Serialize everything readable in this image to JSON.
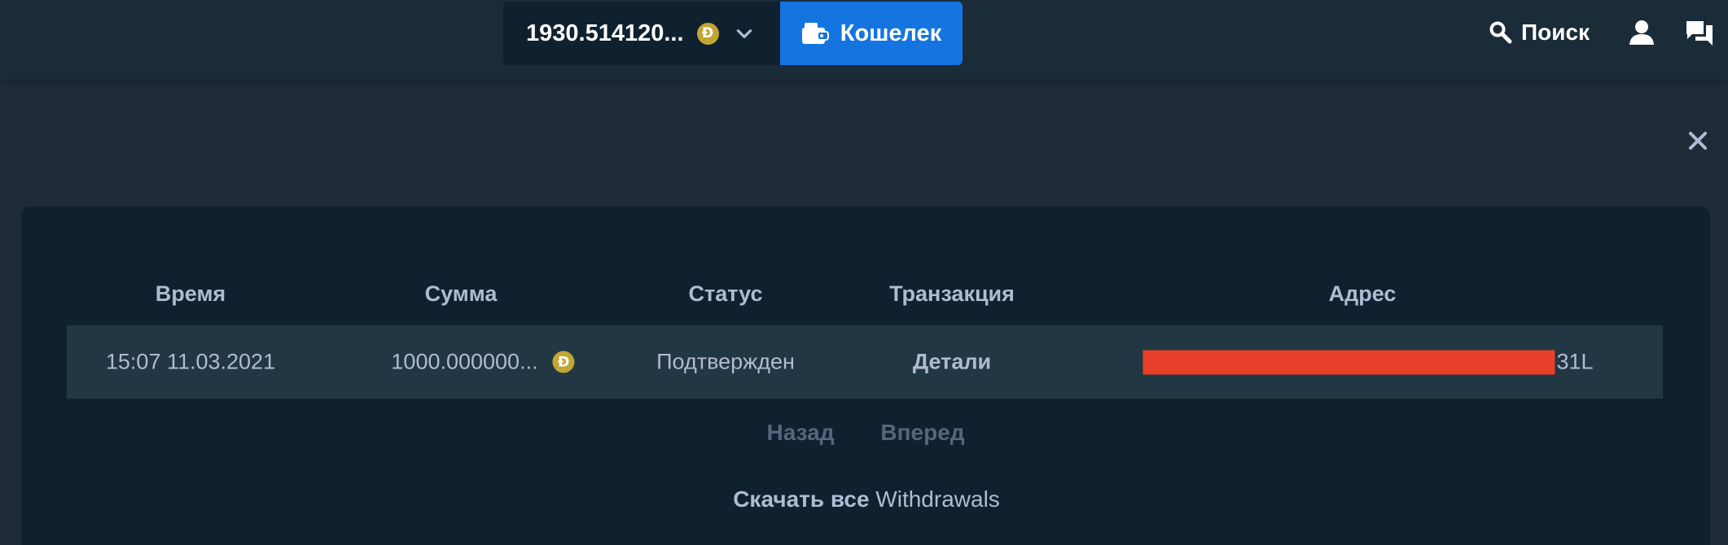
{
  "header": {
    "balance": "1930.514120...",
    "currency_symbol": "Ð",
    "wallet_label": "Кошелек",
    "search_label": "Поиск"
  },
  "table": {
    "columns": [
      "Время",
      "Сумма",
      "Статус",
      "Транзакция",
      "Адрес"
    ],
    "rows": [
      {
        "time": "15:07 11.03.2021",
        "amount": "1000.000000...",
        "status": "Подтвержден",
        "transaction": "Детали",
        "address_tail": "31L"
      }
    ]
  },
  "pagination": {
    "prev": "Назад",
    "next": "Вперед"
  },
  "download": {
    "label": "Скачать все",
    "suffix": "Withdrawals"
  },
  "colors": {
    "accent": "#1475e1",
    "coin": "#c2a633",
    "redaction": "#e8402a"
  },
  "icons": {
    "currency": "dogecoin-icon",
    "wallet": "wallet-icon",
    "search": "search-icon",
    "user": "user-icon",
    "chat": "chat-icon",
    "close": "close-icon",
    "dropdown": "chevron-down-icon"
  }
}
